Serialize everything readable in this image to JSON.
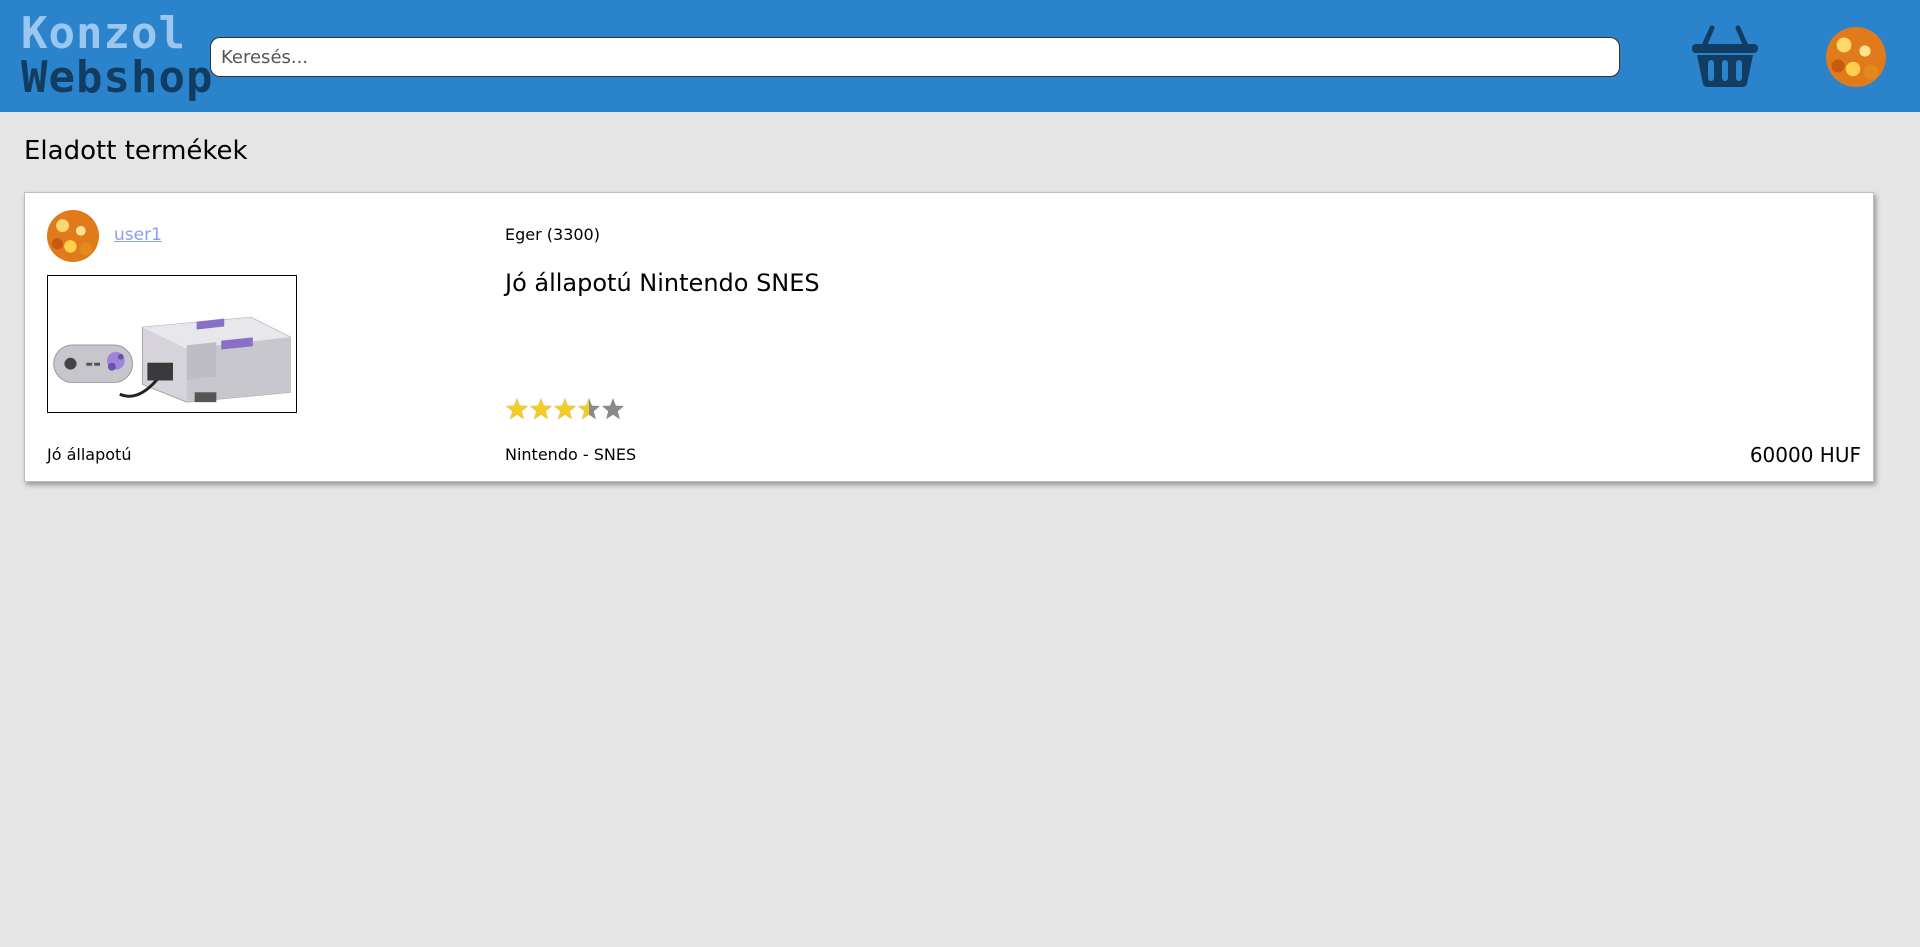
{
  "header": {
    "logo_line1": "Konzol",
    "logo_line2": "Webshop",
    "search_placeholder": "Keresés..."
  },
  "page": {
    "title": "Eladott termékek"
  },
  "product": {
    "seller": "user1",
    "location": "Eger (3300)",
    "title": "Jó állapotú Nintendo SNES",
    "condition": "Jó állapotú",
    "platform": "Nintendo - SNES",
    "price": "60000 HUF",
    "rating": 3.5,
    "rating_max": 5
  },
  "colors": {
    "header_bg": "#2b84cb",
    "star_filled": "#f2cc2a",
    "star_empty": "#8a8a8a"
  }
}
